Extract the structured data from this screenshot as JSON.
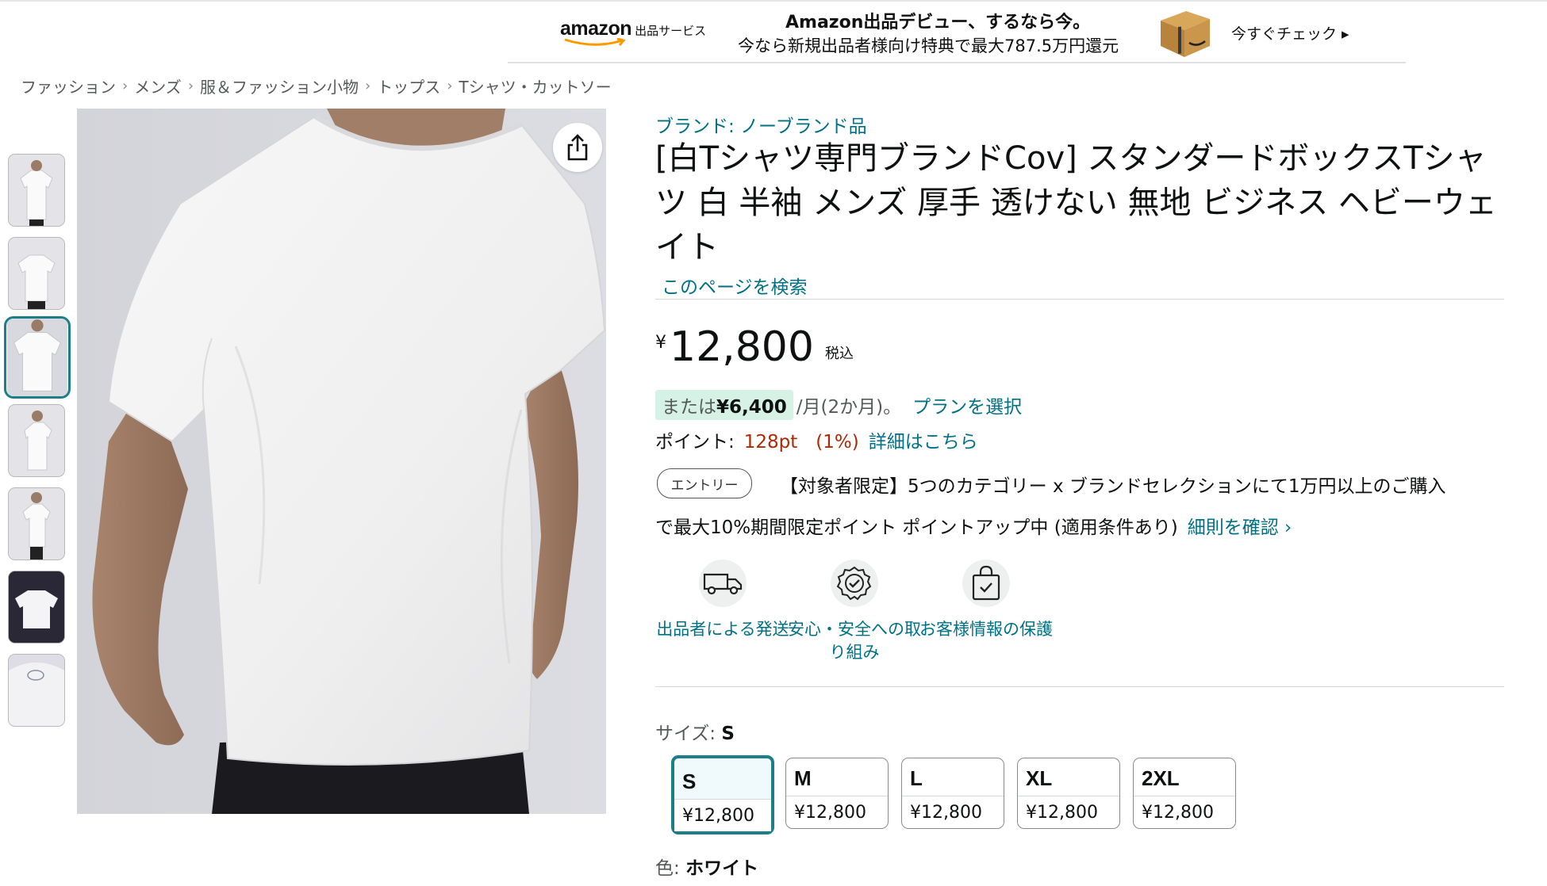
{
  "banner": {
    "logo_word": "amazon",
    "logo_service": "出品サービス",
    "headline": "Amazon出品デビュー、するなら今。",
    "subline": "今なら新規出品者様向け特典で最大787.5万円還元",
    "cta": "今すぐチェック ▸"
  },
  "breadcrumb": {
    "items": [
      "ファッション",
      "メンズ",
      "服＆ファッション小物",
      "トップス",
      "Tシャツ・カットソー"
    ],
    "separator": "›"
  },
  "gallery": {
    "thumbnail_count": 7,
    "selected_index": 2,
    "share_icon": "share-icon"
  },
  "product": {
    "brand": "ブランド: ノーブランド品",
    "title": "[白Tシャツ専門ブランドCov] スタンダードボックスTシャツ 白 半袖 メンズ 厚手 透けない 無地 ビジネス ヘビーウェイト",
    "search_link": "このページを検索"
  },
  "price": {
    "symbol": "¥",
    "value": "12,800",
    "tax_note": "税込"
  },
  "installment": {
    "prefix": "または",
    "amount": "¥6,400",
    "suffix": "/月(2か月)。",
    "link": "プランを選択"
  },
  "points": {
    "label": "ポイント:",
    "value": "128pt　(1%)",
    "link": "詳細はこちら"
  },
  "promotion": {
    "badge": "エントリー",
    "line1": "【対象者限定】5つのカテゴリー x ブランドセレクションにて1万円以上のご購入",
    "line2": "で最大10%期間限定ポイント ポイントアップ中 (適用条件あり)",
    "link": "細則を確認 ›"
  },
  "features": [
    {
      "icon": "delivery-truck-icon",
      "label": "出品者による発送"
    },
    {
      "icon": "safety-badge-icon",
      "label": "安心・安全への取り組み"
    },
    {
      "icon": "secure-bag-icon",
      "label": "お客様情報の保護"
    }
  ],
  "size": {
    "label": "サイズ:",
    "selected": "S",
    "options": [
      {
        "name": "S",
        "price": "¥12,800"
      },
      {
        "name": "M",
        "price": "¥12,800"
      },
      {
        "name": "L",
        "price": "¥12,800"
      },
      {
        "name": "XL",
        "price": "¥12,800"
      },
      {
        "name": "2XL",
        "price": "¥12,800"
      }
    ]
  },
  "color": {
    "label": "色:",
    "selected": "ホワイト"
  },
  "colors": {
    "link": "#007185",
    "accent_teal": "#1b7e89",
    "points_red": "#b12704",
    "installment_bg": "#d6f2e6"
  }
}
